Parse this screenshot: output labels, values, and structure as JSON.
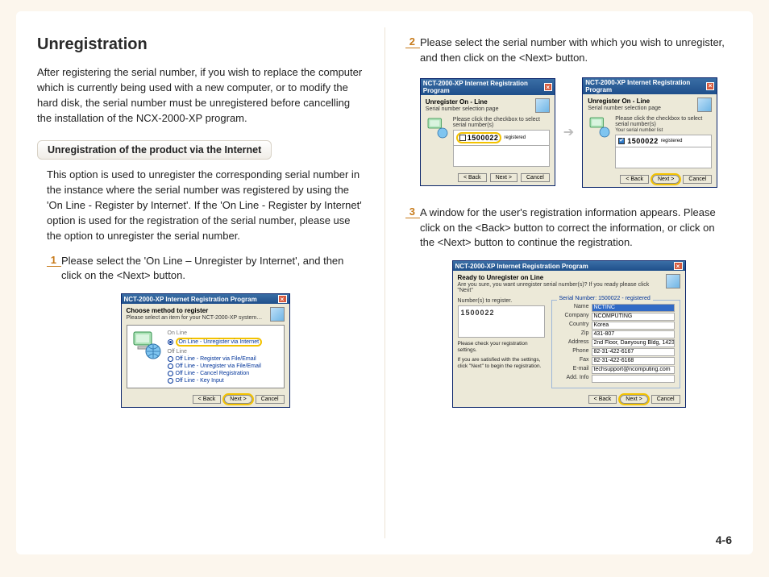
{
  "heading": "Unregistration",
  "intro": "After registering the serial number, if you wish to replace the computer which is currently being used with a new computer, or to modify the hard disk, the serial number must be unregistered before cancelling the installation of the NCX-2000-XP program.",
  "subhead": "Unregistration of the product via the Internet",
  "sub_desc": "This option is used to unregister the corresponding serial number in the instance where the serial number was registered by using the 'On Line - Register by Internet'. If the 'On Line - Register by Internet' option is used for the registration of the serial number, please use the option to unregister the serial number.",
  "steps": {
    "s1": {
      "num": "1",
      "text": "Please select the 'On Line – Unregister by Internet', and then click on the <Next> button."
    },
    "s2": {
      "num": "2",
      "text": "Please select the serial number with which you wish to unregister, and then click on the <Next> button."
    },
    "s3": {
      "num": "3",
      "text": "A window for the user's registration information appears. Please click on the <Back> button to correct the information, or click on the <Next> button to continue the registration."
    }
  },
  "dlg1": {
    "title": "NCT-2000-XP Internet Registration Program",
    "section": "Choose method to register",
    "sub": "Please select an item for your NCT-2000-XP system…",
    "group_online": "On Line",
    "opt_online_unreg": "On Line - Unregister via Internet",
    "group_offline": "Off Line",
    "opt_off1": "Off Line - Register via File/Email",
    "opt_off2": "Off Line - Unregister via File/Email",
    "opt_off3": "Off Line - Cancel Registration",
    "opt_off4": "Off Line - Key Input",
    "btn_back": "< Back",
    "btn_next": "Next >",
    "btn_cancel": "Cancel"
  },
  "dlg2": {
    "title": "NCT-2000-XP Internet Registration Program",
    "section": "Unregister On - Line",
    "sub": "Serial number selection page",
    "instr": "Please click the checkbox to select serial number(s)",
    "listlabel": "Your serial number list",
    "serial": "1500022",
    "status": "registered",
    "btn_back": "< Back",
    "btn_next": "Next >",
    "btn_cancel": "Cancel"
  },
  "dlg3": {
    "title": "NCT-2000-XP Internet Registration Program",
    "section": "Ready to Unregister on Line",
    "sub": "Are you sure, you want unregister serial number(s)? If you ready please click \"Next\"",
    "left_lbl": "Number(s) to register.",
    "serial": "1500022",
    "left_note1": "Please check your registration settings.",
    "left_note2": "If you are satisfied with the settings, click \"Next\" to begin the registration.",
    "legend": "Serial Number: 1500022  -  registered",
    "fields": {
      "name_l": "Name",
      "name": "NCTINC",
      "company_l": "Company",
      "company": "NCOMPUTING",
      "country_l": "Country",
      "country": "Korea",
      "zip_l": "Zip",
      "zip": "431-807",
      "address_l": "Address",
      "address": "2nd Floor, Daeyoung Bldg, 1423",
      "phone_l": "Phone",
      "phone": "82-31-422-6167",
      "fax_l": "Fax",
      "fax": "82-31-422-6168",
      "email_l": "E-mail",
      "email": "techsupport@ncomputing.com",
      "add_l": "Add. Info",
      "add": ""
    },
    "btn_back": "< Back",
    "btn_next": "Next >",
    "btn_cancel": "Cancel"
  },
  "page_num": "4-6"
}
